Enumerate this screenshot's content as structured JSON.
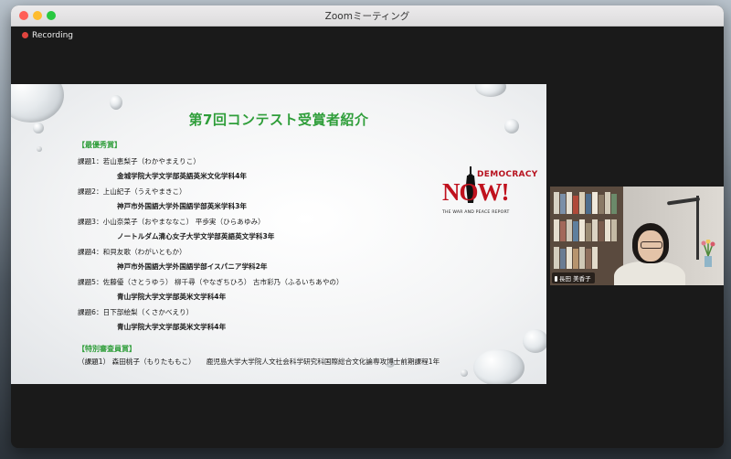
{
  "window": {
    "title": "Zoomミーティング"
  },
  "recording": {
    "label": "Recording"
  },
  "slide": {
    "title": "第7回コンテスト受賞者紹介",
    "best_label": "【最優秀賞】",
    "tasks": [
      {
        "task": "課題1：若山恵梨子（わかやまえりこ）",
        "affiliation": "金城学院大学文学部英語英米文化学科4年"
      },
      {
        "task": "課題2：上山紀子（うえやまきこ）",
        "affiliation": "神戸市外国語大学外国語学部英米学科3年"
      },
      {
        "task": "課題3：小山奈菜子（おやまななこ） 平歩実（ひらあゆみ）",
        "affiliation": "ノートルダム清心女子大学文学部英語英文学科3年"
      },
      {
        "task": "課題4：和貝友歌（わがいともか）",
        "affiliation": "神戸市外国語大学外国語学部イスパニア学科2年"
      },
      {
        "task": "課題5：佐藤優（さとうゆう） 柳千尋（やなぎちひろ） 古市彩乃（ふるいちあやの）",
        "affiliation": "青山学院大学文学部英米文学科4年"
      },
      {
        "task": "課題6：日下部絵梨（くさかべえり）",
        "affiliation": "青山学院大学文学部英米文学科4年"
      }
    ],
    "special_label": "【特別審査員賞】",
    "special_task": "（課題1） 森田桃子（もりたももこ）",
    "special_affiliation": "鹿児島大学大学院人文社会科学研究科国際総合文化論専攻博士前期課程1年"
  },
  "logo": {
    "top": "DEMOCRACY",
    "big": "NOW!",
    "sub": "THE WAR AND PEACE REPORT"
  },
  "participant": {
    "name": "長田 美香子"
  },
  "colors": {
    "accent_green": "#2f9e3a",
    "logo_red": "#c0121e",
    "record_red": "#e0443e"
  }
}
